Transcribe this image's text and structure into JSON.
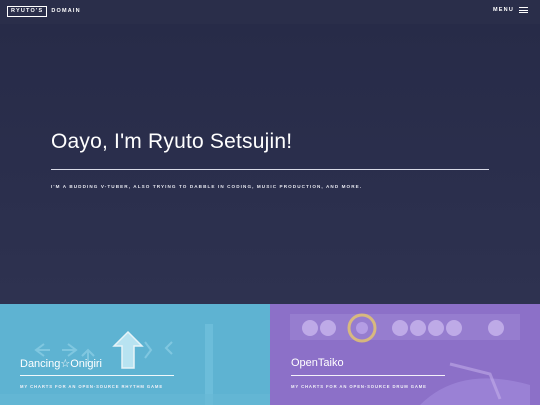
{
  "header": {
    "logo_box": "RYUTO'S",
    "logo_rest": "DOMAIN",
    "menu_label": "MENU",
    "menu_icon": "hamburger-icon"
  },
  "hero": {
    "title": "Oayo, I'm Ryuto Setsujin!",
    "subtitle": "I'M A BUDDING V-TUBER, ALSO TRYING TO DABBLE IN CODING, MUSIC PRODUCTION, AND MORE."
  },
  "projects": [
    {
      "title": "Dancing☆Onigiri",
      "subtitle": "MY CHARTS FOR AN OPEN-SOURCE RHYTHM GAME"
    },
    {
      "title": "OpenTaiko",
      "subtitle": "MY CHARTS FOR AN OPEN-SOURCE DRUM GAME"
    }
  ],
  "colors": {
    "background": "#2a2e4a",
    "tile_dancing": "#5bb0cf",
    "tile_opentaiko": "#8d71c9",
    "text": "#ffffff"
  }
}
